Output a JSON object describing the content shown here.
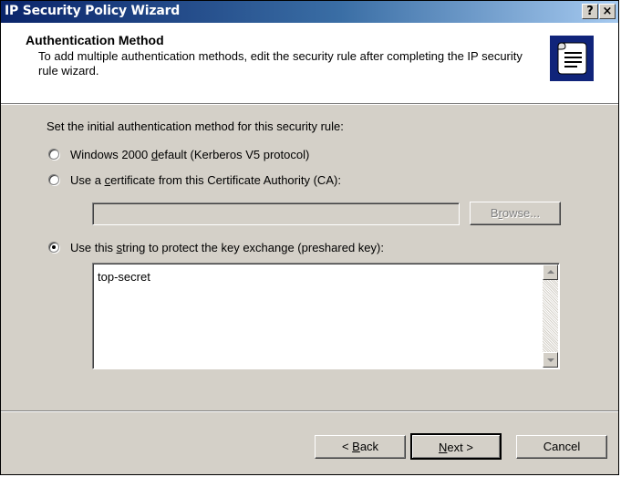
{
  "window": {
    "title": "IP Security Policy Wizard",
    "help_label": "?",
    "close_label": "×"
  },
  "header": {
    "title": "Authentication Method",
    "description": "To add multiple authentication methods, edit the security rule after completing the IP security rule wizard.",
    "icon": "scroll-document-icon"
  },
  "body": {
    "instruction": "Set the initial authentication method for this security rule:",
    "options": [
      {
        "pre": "Windows 2000 ",
        "mnemonic": "d",
        "post": "efault (Kerberos V5 protocol)",
        "checked": false
      },
      {
        "pre": "Use a ",
        "mnemonic": "c",
        "post": "ertificate from this Certificate Authority (CA):",
        "checked": false
      },
      {
        "pre": "Use this ",
        "mnemonic": "s",
        "post": "tring to protect the key exchange (preshared key):",
        "checked": true
      }
    ],
    "ca_field_value": "",
    "browse": {
      "pre": "B",
      "mnemonic": "r",
      "post": "owse...",
      "enabled": false
    },
    "preshared_key": "top-secret"
  },
  "footer": {
    "back": {
      "pre": "< ",
      "mnemonic": "B",
      "post": "ack"
    },
    "next": {
      "pre": "",
      "mnemonic": "N",
      "post": "ext >"
    },
    "cancel": "Cancel"
  },
  "colors": {
    "titlebar_start": "#0a246a",
    "titlebar_end": "#a6caf0",
    "face": "#d4d0c8",
    "header_bg": "#ffffff",
    "icon_bg": "#10247a"
  }
}
